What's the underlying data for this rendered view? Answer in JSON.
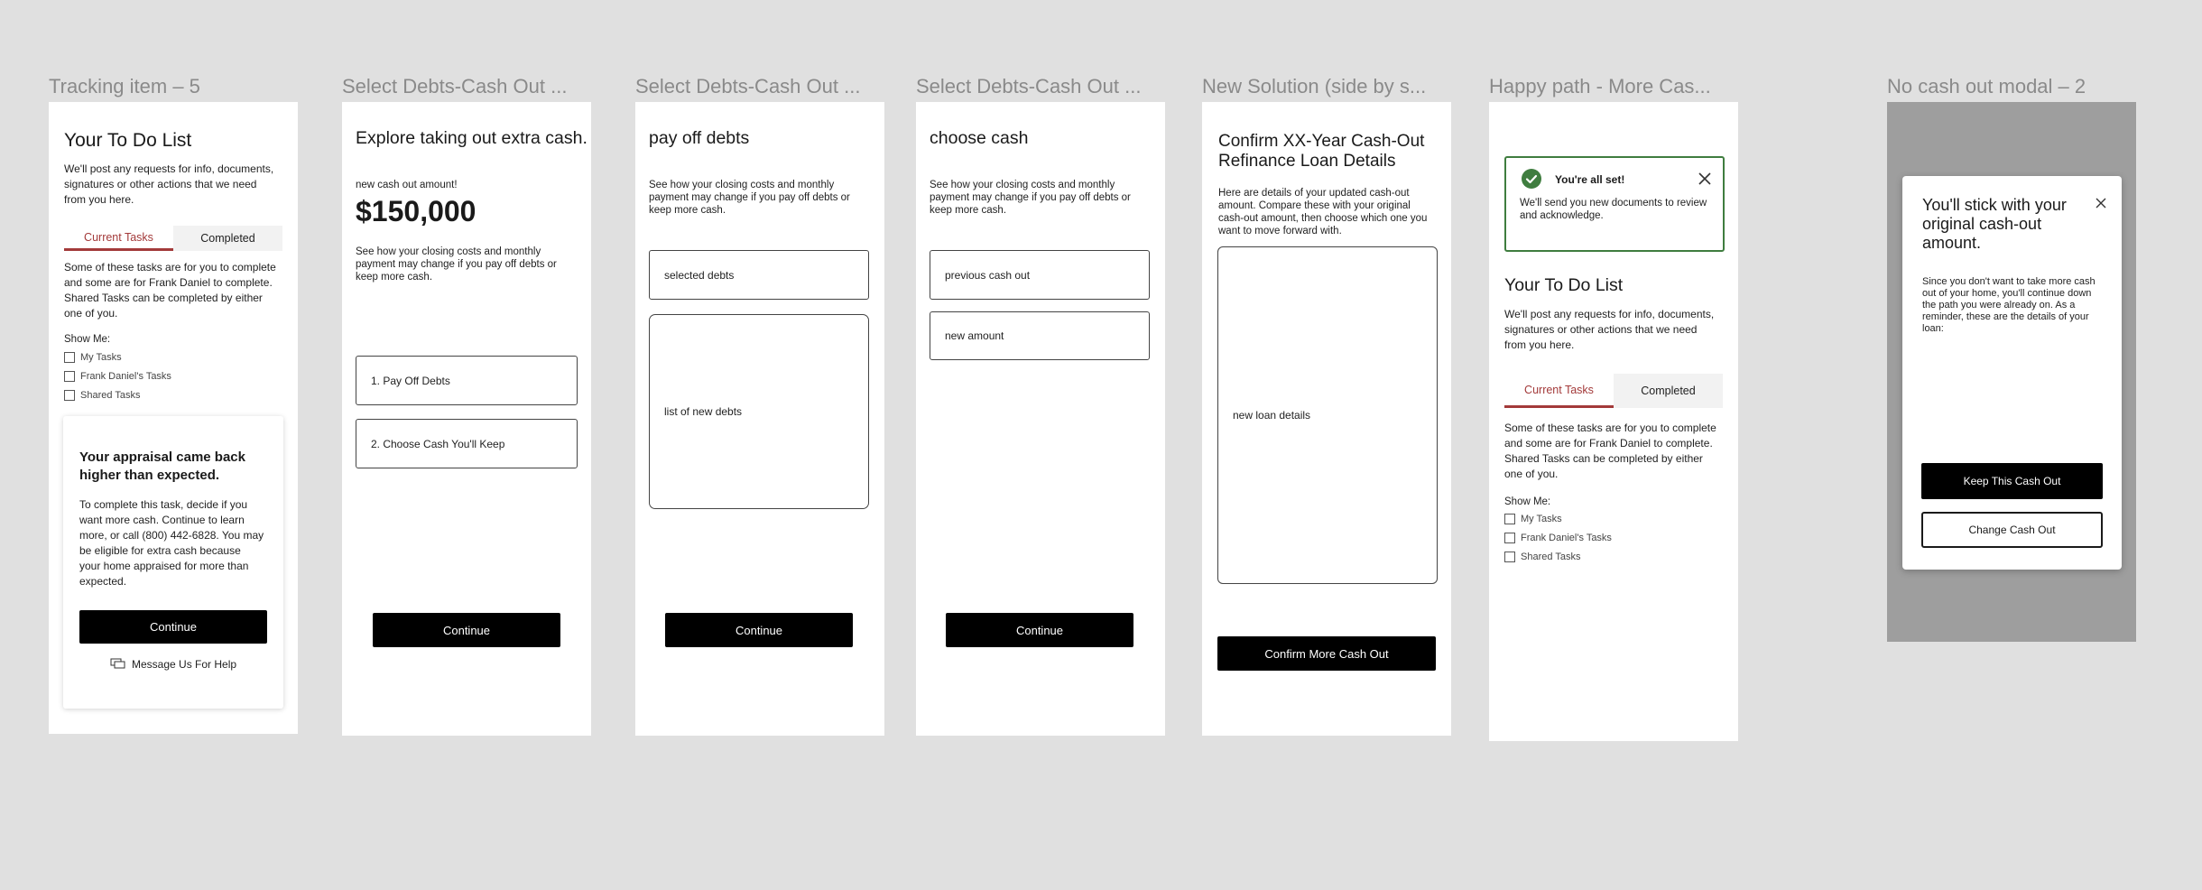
{
  "frames": {
    "tracking": {
      "label": "Tracking item – 5",
      "title": "Your To Do List",
      "intro": "We'll post any requests for info, documents, signatures or other actions that we need from you here.",
      "tab_current": "Current Tasks",
      "tab_completed": "Completed",
      "desc": "Some of these tasks are for you to complete and some are for Frank Daniel to complete. Shared Tasks can be completed by either one of you.",
      "show_me": "Show Me:",
      "filters": [
        "My Tasks",
        "Frank Daniel's Tasks",
        "Shared Tasks"
      ],
      "card_title": "Your appraisal came back higher than expected.",
      "card_body": "To complete this task, decide if you want more cash. Continue to learn more, or call (800) 442-6828. You may be eligible for extra cash because your home appraised for more than expected.",
      "continue": "Continue",
      "message": "Message Us For Help"
    },
    "select1": {
      "label": "Select Debts-Cash Out ...",
      "title": "Explore taking out extra cash.",
      "amount_label": "new cash out amount!",
      "amount": "$150,000",
      "desc": "See how your closing costs and monthly payment may change if you pay off debts or keep more cash.",
      "option1": "1. Pay Off Debts",
      "option2": "2. Choose Cash You'll Keep",
      "continue": "Continue"
    },
    "select2": {
      "label": "Select Debts-Cash Out ...",
      "title": "pay off debts",
      "desc": "See how your closing costs and monthly payment may change if you pay off debts or keep more cash.",
      "box1": "selected debts",
      "box2": "list of new debts",
      "continue": "Continue"
    },
    "select3": {
      "label": "Select Debts-Cash Out ...",
      "title": "choose cash",
      "desc": "See how your closing costs and monthly payment may change if you pay off debts or keep more cash.",
      "box1": "previous cash out",
      "box2": "new amount",
      "continue": "Continue"
    },
    "solution": {
      "label": "New Solution (side by s...",
      "title": "Confirm XX-Year Cash-Out Refinance Loan Details",
      "desc": "Here are details of your updated cash-out amount. Compare these with your original cash-out amount, then choose which one you want to move forward with.",
      "box": "new loan details",
      "confirm": "Confirm More Cash Out"
    },
    "happy": {
      "label": "Happy path - More Cas...",
      "alert_title": "You're all set!",
      "alert_body": "We'll send you new documents to review and acknowledge.",
      "title": "Your To Do List",
      "intro": "We'll post any requests for info, documents, signatures or other actions that we need from you here.",
      "tab_current": "Current Tasks",
      "tab_completed": "Completed",
      "desc": "Some of these tasks are for you to complete and some are for Frank Daniel to complete. Shared Tasks can be completed by either one of you.",
      "show_me": "Show Me:",
      "filters": [
        "My Tasks",
        "Frank Daniel's Tasks",
        "Shared Tasks"
      ]
    },
    "modal": {
      "label": "No cash out modal – 2",
      "title": "You'll stick with your original cash-out amount.",
      "body": "Since you don't want to take more cash out of your home, you'll continue down the path you were already on. As a reminder, these are the details of your loan:",
      "keep": "Keep This Cash Out",
      "change": "Change Cash Out"
    }
  },
  "colors": {
    "accent": "#a33a3a",
    "success": "#3f7d3f",
    "overlay": "#9e9e9e"
  }
}
